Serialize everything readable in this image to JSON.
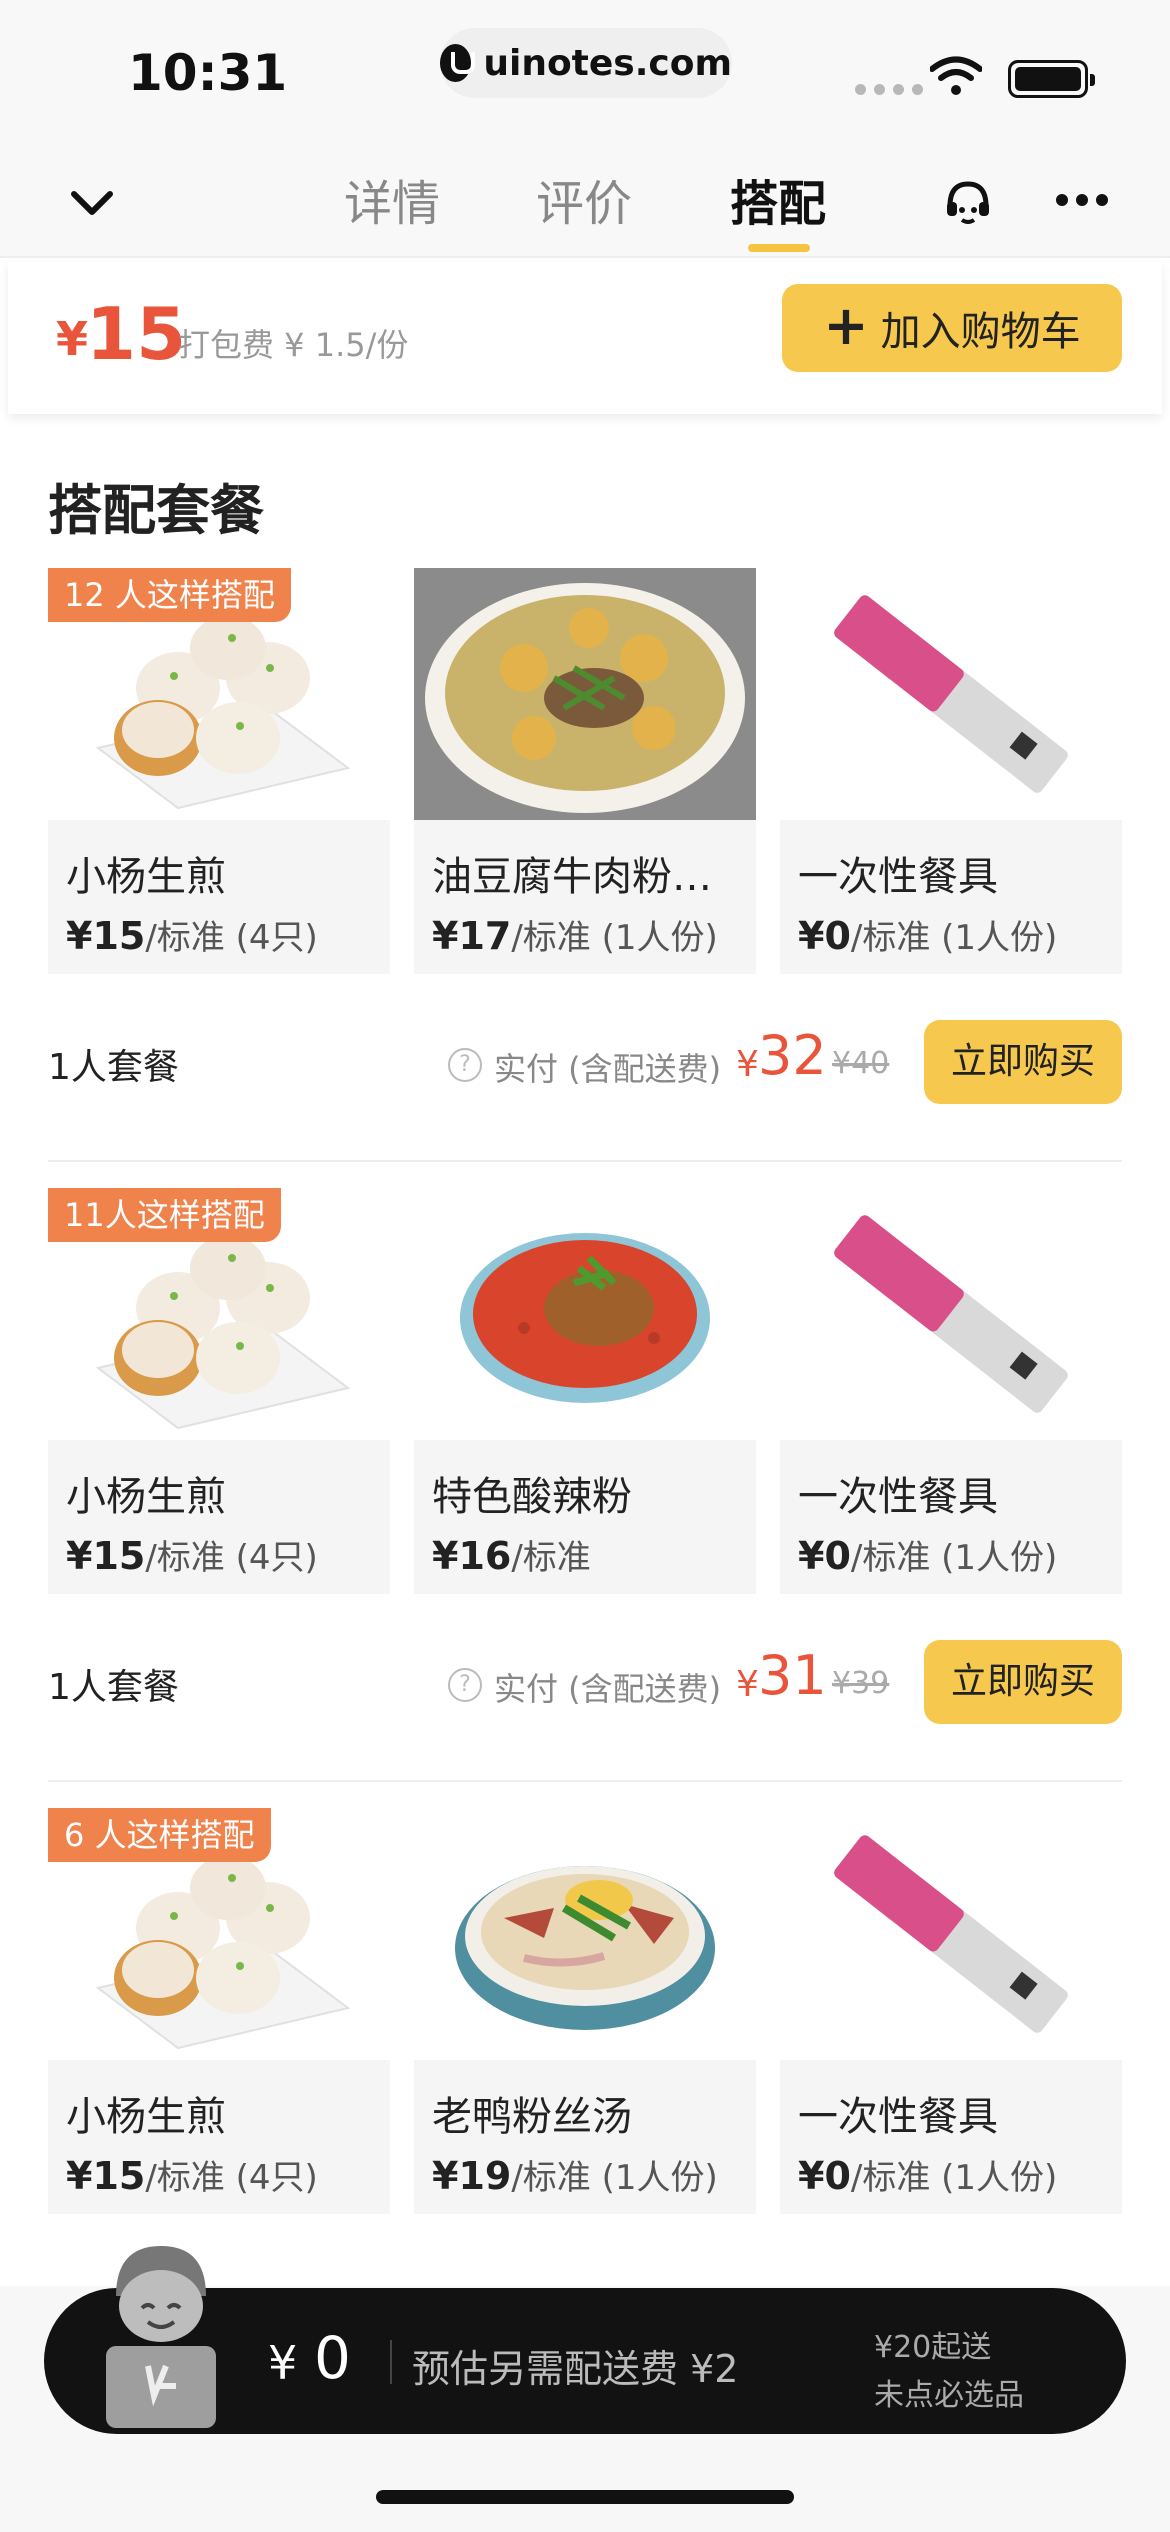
{
  "status": {
    "time": "10:31",
    "url": "uinotes.com"
  },
  "nav": {
    "tabs": [
      {
        "label": "详情"
      },
      {
        "label": "评价"
      },
      {
        "label": "搭配"
      }
    ],
    "active_tab": "搭配"
  },
  "price_bar": {
    "currency": "¥",
    "price": "15",
    "pack_fee": "打包费 ¥ 1.5/份",
    "add_cart_label": "加入购物车"
  },
  "section_title": "搭配套餐",
  "combos": [
    {
      "badge": "12 人这样搭配",
      "items": [
        {
          "name": "小杨生煎",
          "price": "¥15",
          "unit": "/标准 (4只)"
        },
        {
          "name": "油豆腐牛肉粉丝汤",
          "price": "¥17",
          "unit": "/标准 (1人份)"
        },
        {
          "name": "一次性餐具",
          "price": "¥0",
          "unit": "/标准 (1人份)"
        }
      ],
      "combo_name": "1人套餐",
      "paid_label": "实付 (含配送费)",
      "paid_currency": "¥",
      "paid_amount": "32",
      "original": "¥40",
      "buy_label": "立即购买"
    },
    {
      "badge": "11人这样搭配",
      "items": [
        {
          "name": "小杨生煎",
          "price": "¥15",
          "unit": "/标准 (4只)"
        },
        {
          "name": "特色酸辣粉",
          "price": "¥16",
          "unit": "/标准"
        },
        {
          "name": "一次性餐具",
          "price": "¥0",
          "unit": "/标准 (1人份)"
        }
      ],
      "combo_name": "1人套餐",
      "paid_label": "实付 (含配送费)",
      "paid_currency": "¥",
      "paid_amount": "31",
      "original": "¥39",
      "buy_label": "立即购买"
    },
    {
      "badge": "6 人这样搭配",
      "items": [
        {
          "name": "小杨生煎",
          "price": "¥15",
          "unit": "/标准 (4只)"
        },
        {
          "name": "老鸭粉丝汤",
          "price": "¥19",
          "unit": "/标准 (1人份)"
        },
        {
          "name": "一次性餐具",
          "price": "¥0",
          "unit": "/标准 (1人份)"
        }
      ]
    }
  ],
  "cart": {
    "currency": "¥",
    "amount": "0",
    "estimate": "预估另需配送费 ¥2",
    "min_order": "¥20起送",
    "must_choose": "未点必选品"
  },
  "colors": {
    "accent_yellow": "#f6c84e",
    "price_red": "#e8553a",
    "badge_orange": "#f0824c",
    "cart_bg": "#121212"
  }
}
